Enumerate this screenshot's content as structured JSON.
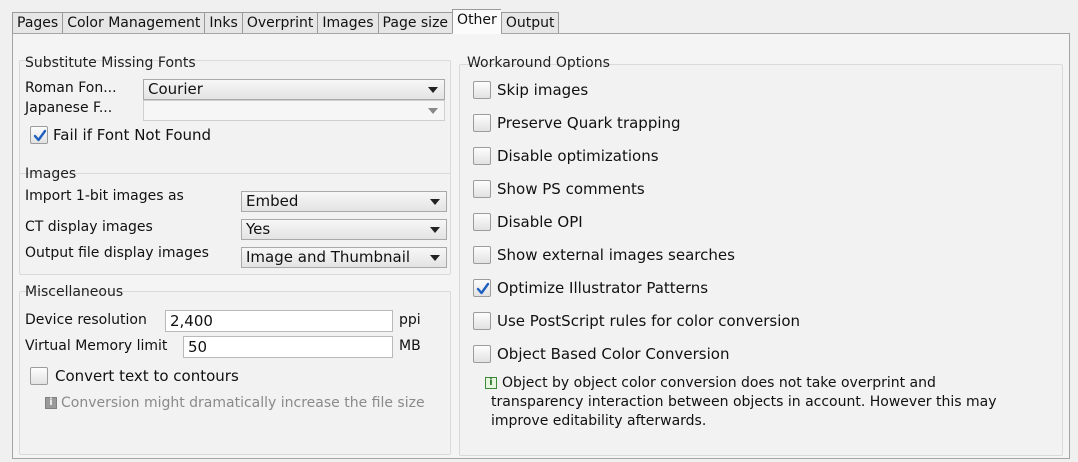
{
  "tabs": [
    "Pages",
    "Color Management",
    "Inks",
    "Overprint",
    "Images",
    "Page size",
    "Other",
    "Output"
  ],
  "active_tab": "Other",
  "fonts": {
    "title": "Substitute Missing Fonts",
    "roman_label": "Roman Fon...",
    "roman_value": "Courier",
    "japanese_label": "Japanese F...",
    "japanese_value": "",
    "fail_label": "Fail if Font Not Found",
    "fail_checked": true
  },
  "images": {
    "title": "Images",
    "import_label": "Import 1-bit images as",
    "import_value": "Embed",
    "ct_label": "CT display images",
    "ct_value": "Yes",
    "output_label": "Output file display images",
    "output_value": "Image and Thumbnail"
  },
  "misc": {
    "title": "Miscellaneous",
    "resolution_label": "Device resolution",
    "resolution_value": "2,400",
    "resolution_unit": "ppi",
    "memory_label": "Virtual Memory limit",
    "memory_value": "50",
    "memory_unit": "MB",
    "convert_label": "Convert text to contours",
    "convert_checked": false,
    "convert_note": "Conversion might dramatically increase the file size"
  },
  "workaround": {
    "title": "Workaround Options",
    "options": [
      {
        "label": "Skip images",
        "checked": false
      },
      {
        "label": "Preserve Quark trapping",
        "checked": false
      },
      {
        "label": "Disable optimizations",
        "checked": false
      },
      {
        "label": "Show PS comments",
        "checked": false
      },
      {
        "label": "Disable OPI",
        "checked": false
      },
      {
        "label": "Show external images searches",
        "checked": false
      },
      {
        "label": "Optimize Illustrator Patterns",
        "checked": true
      },
      {
        "label": "Use PostScript rules for color conversion",
        "checked": false
      },
      {
        "label": "Object Based Color Conversion",
        "checked": false
      }
    ],
    "note_lines": [
      "Object by object color conversion does not take overprint and",
      "transparency interaction between objects in account. However this may",
      "improve editability afterwards."
    ]
  },
  "colors": {
    "check": "#1f5fbf",
    "info_green": "#2a7a2a"
  }
}
